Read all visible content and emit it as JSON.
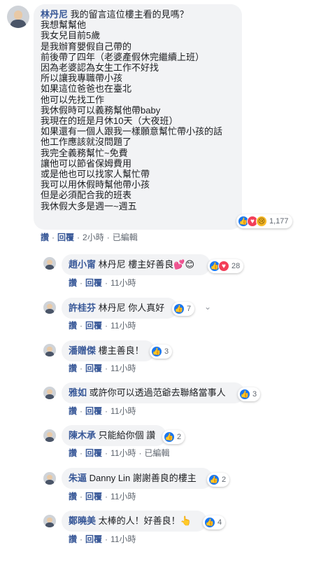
{
  "main_comment": {
    "author": "林丹尼",
    "body": " 我的留言這位樓主看的見嗎？\n我想幫幫他\n我女兒目前5歲\n是我辦育嬰假自己帶的\n前後帶了四年（老婆產假休完繼續上班）\n因為老婆認為女生工作不好找\n所以讓我專職帶小孩\n如果這位爸爸也在臺北\n他可以先找工作\n我休假時可以義務幫他帶baby\n我現在的班是月休10天（大夜班）\n如果還有一個人跟我一樣願意幫忙帶小孩的話\n他工作應該就沒問題了\n我完全義務幫忙~免費\n讓他可以節省保姆費用\n或是他也可以找家人幫忙帶\n我可以用休假時幫他帶小孩\n但是必須配合我的班表\n我休假大多是週一~週五",
    "reaction_count": "1,177",
    "like_label": "讚",
    "reply_label": "回覆",
    "time": "2小時",
    "edited": "已編輯"
  },
  "replies": [
    {
      "author": "趙小甯",
      "text": "林丹尼 樓主好善良",
      "emoji": "💕😊",
      "count": "28",
      "like_label": "讚",
      "reply_label": "回覆",
      "time": "11小時"
    },
    {
      "author": "許桂芬",
      "text": "林丹尼 你人真好",
      "emoji": "",
      "count": "7",
      "like_label": "讚",
      "reply_label": "回覆",
      "time": "11小時"
    },
    {
      "author": "潘贈傑",
      "text": "樓主善良！",
      "emoji": "",
      "count": "3",
      "like_label": "讚",
      "reply_label": "回覆",
      "time": "11小時"
    },
    {
      "author": "雅如",
      "text": "或許你可以透過范爺去聯絡當事人",
      "emoji": "",
      "count": "3",
      "like_label": "讚",
      "reply_label": "回覆",
      "time": "11小時"
    },
    {
      "author": "陳木承",
      "text": "只能給你個 讚",
      "emoji": "",
      "count": "2",
      "like_label": "讚",
      "reply_label": "回覆",
      "time": "11小時",
      "edited": "已編輯"
    },
    {
      "author": "朱逼",
      "text": "Danny Lin 謝謝善良的樓主",
      "emoji": "",
      "count": "2",
      "like_label": "讚",
      "reply_label": "回覆",
      "time": "11小時"
    },
    {
      "author": "鄭曉美",
      "text": "太棒的人！好善良！",
      "emoji": "👆",
      "count": "4",
      "like_label": "讚",
      "reply_label": "回覆",
      "time": "11小時"
    }
  ],
  "icons": {
    "like": "like-icon",
    "love": "love-icon",
    "sad": "sad-icon",
    "more": "chevron-down-icon"
  },
  "colors": {
    "link": "#385898",
    "bubble": "#f2f3f5",
    "like": "#1877f2",
    "love": "#f33e58"
  }
}
